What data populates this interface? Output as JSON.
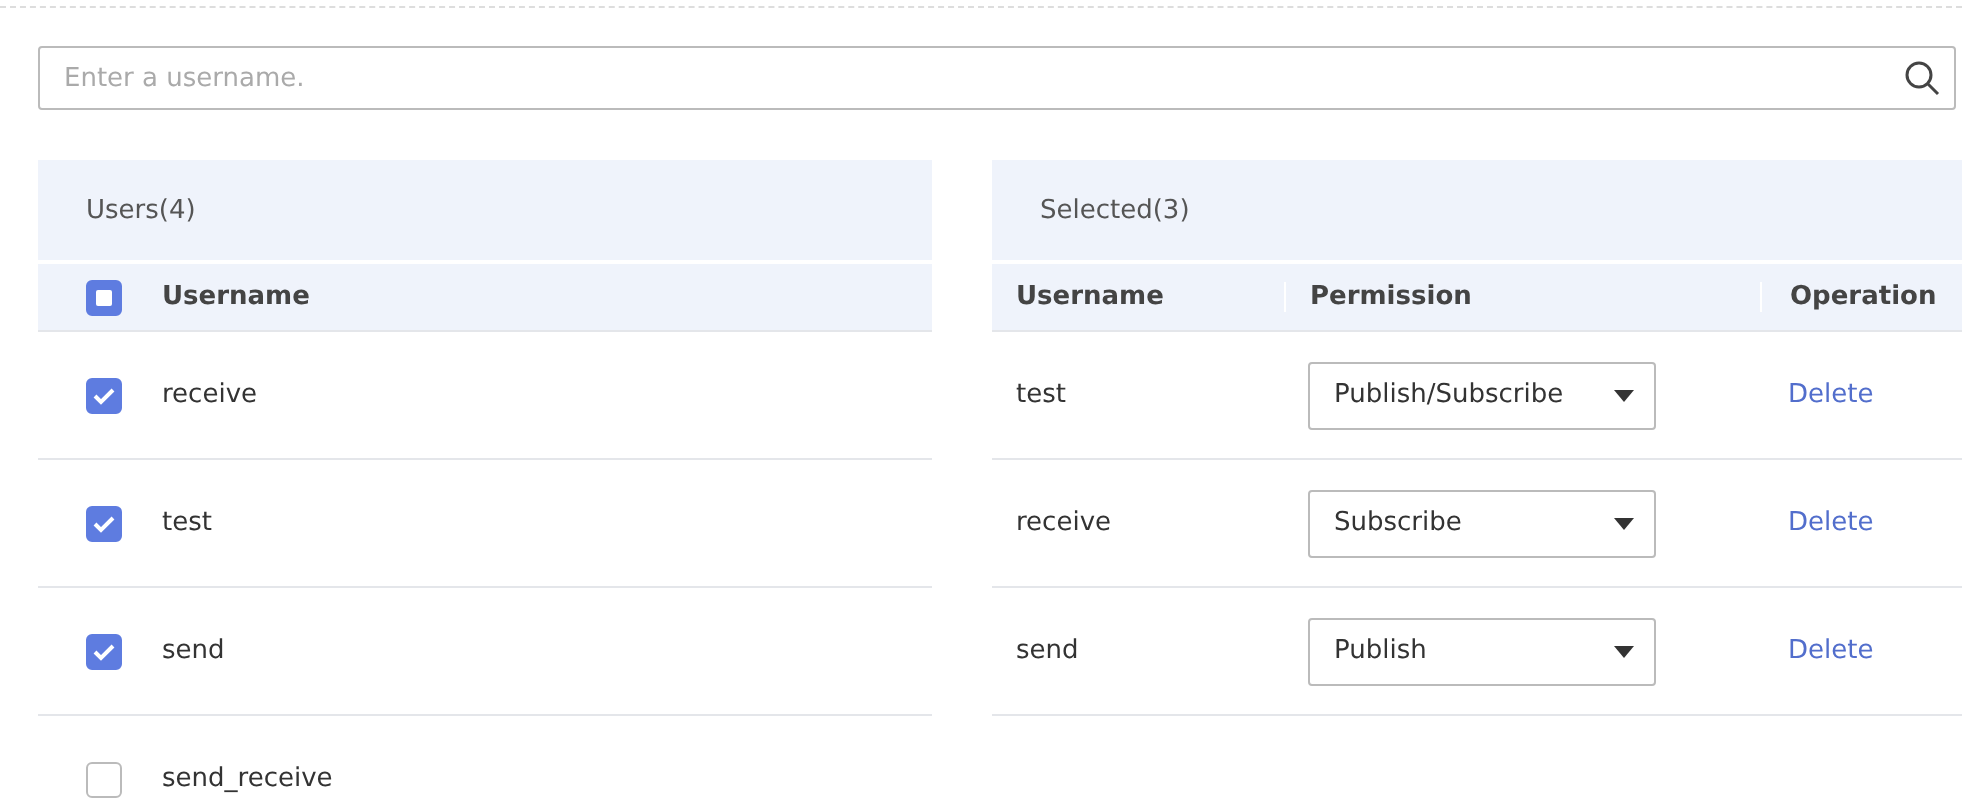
{
  "search": {
    "placeholder": "Enter a username."
  },
  "users": {
    "title": "Users(4)",
    "select_all": {
      "indeterminate": true
    },
    "column": "Username",
    "rows": [
      {
        "name": "receive",
        "checked": true
      },
      {
        "name": "test",
        "checked": true
      },
      {
        "name": "send",
        "checked": true
      },
      {
        "name": "send_receive",
        "checked": false
      }
    ]
  },
  "selected": {
    "title": "Selected(3)",
    "columns": [
      "Username",
      "Permission",
      "Operation"
    ],
    "rows": [
      {
        "name": "test",
        "permission": "Publish/Subscribe",
        "action": "Delete"
      },
      {
        "name": "receive",
        "permission": "Subscribe",
        "action": "Delete"
      },
      {
        "name": "send",
        "permission": "Publish",
        "action": "Delete"
      }
    ]
  }
}
